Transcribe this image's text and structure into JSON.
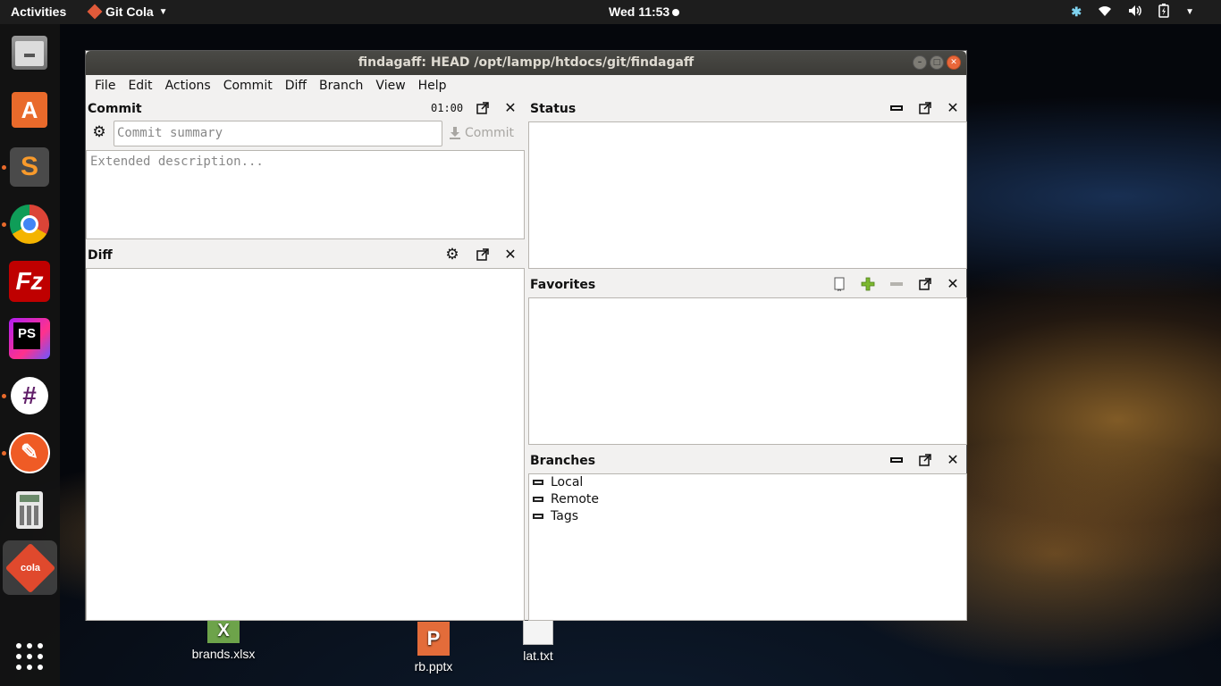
{
  "topbar": {
    "activities": "Activities",
    "app_name": "Git Cola",
    "clock": "Wed 11:53"
  },
  "desktop_icons": [
    {
      "label": "brands.xlsx",
      "type": "spreadsheet"
    },
    {
      "label": "rb.pptx",
      "type": "presentation"
    },
    {
      "label": "lat.txt",
      "type": "text"
    }
  ],
  "dock": {
    "apps": [
      "files",
      "software-center",
      "sublime-text",
      "chrome",
      "filezilla",
      "phpstorm",
      "slack",
      "postman",
      "calculator",
      "git-cola",
      "show-applications"
    ]
  },
  "window": {
    "title": "findagaff: HEAD /opt/lampp/htdocs/git/findagaff",
    "menu": [
      "File",
      "Edit",
      "Actions",
      "Commit",
      "Diff",
      "Branch",
      "View",
      "Help"
    ],
    "commit_panel": {
      "title": "Commit",
      "timer": "01:00",
      "summary_placeholder": "Commit summary",
      "description_placeholder": "Extended description...",
      "commit_button": "Commit"
    },
    "diff_panel": {
      "title": "Diff"
    },
    "status_panel": {
      "title": "Status"
    },
    "favorites_panel": {
      "title": "Favorites"
    },
    "branches_panel": {
      "title": "Branches",
      "items": [
        "Local",
        "Remote",
        "Tags"
      ]
    }
  },
  "colors": {
    "topbar": "#1d1d1d",
    "window_bg": "#f2f1f0",
    "close_button": "#e9673a",
    "accent_orange": "#e96a2b",
    "favorites_add": "#7cb82f"
  }
}
